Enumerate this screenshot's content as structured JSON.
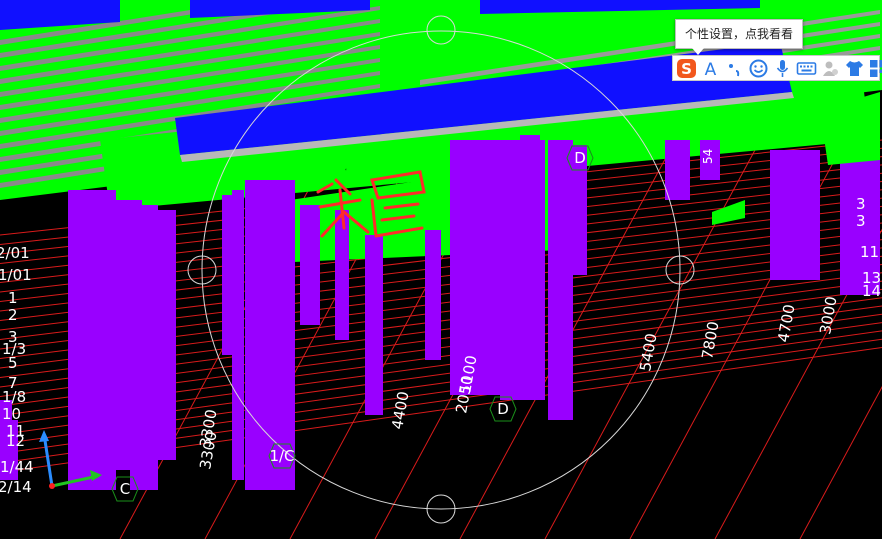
{
  "ime": {
    "tooltip": "个性设置，点我看看",
    "toolbar_icons": [
      "sogou-logo-icon",
      "font-icon",
      "punctuation-icon",
      "emoji-icon",
      "microphone-icon",
      "keyboard-icon",
      "user-icon",
      "skin-shirt-icon",
      "toolbox-icon"
    ]
  },
  "viewport": {
    "annotation": "楼层",
    "left_axis_labels": [
      "2/01",
      "1/01",
      "1",
      "2",
      "3",
      "1/3",
      "5",
      "7",
      "1/8",
      "10",
      "11",
      "12",
      "1/44",
      "2/14"
    ],
    "right_axis_labels": [
      "3",
      "3",
      "11",
      "13",
      "14"
    ],
    "top_right_label": "54",
    "grid_bubbles": [
      "D",
      "D",
      "1/C",
      "C"
    ],
    "dimensions": [
      "3300",
      "3300",
      "4400",
      "2050",
      "1100",
      "5400",
      "7800",
      "4700",
      "3000"
    ]
  },
  "colors": {
    "slab_green": "#00ff00",
    "column_purple": "#9900ff",
    "beam_blue": "#0000ff",
    "grid_red": "#ff2020",
    "annotation_red": "#ff2a2a"
  }
}
